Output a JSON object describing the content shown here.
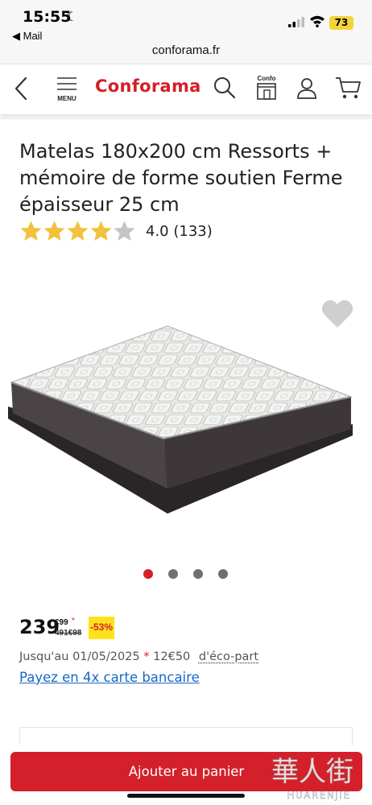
{
  "status_bar": {
    "time": "15:55",
    "back_app": "◀ Mail",
    "battery": "73"
  },
  "browser": {
    "url": "conforama.fr"
  },
  "header": {
    "menu_label": "MENU",
    "logo": "Conforama",
    "confo_label": "Confo"
  },
  "product": {
    "title": "Matelas 180x200 cm Ressorts + mémoire de forme soutien Ferme épaisseur 25 cm",
    "rating": 4.0,
    "rating_text": "4.0 (133)",
    "image_count": 4,
    "active_image": 1
  },
  "price": {
    "main": "239",
    "cents": "€99",
    "asterisk": "*",
    "old_price": "491€98",
    "discount": "-53%"
  },
  "eco": {
    "date_text": "Jusqu'au 01/05/2025",
    "asterisk": "*",
    "amount": "12€50",
    "link": "d'éco-part"
  },
  "payment_link": "Payez en 4x carte bancaire",
  "cta": {
    "add_to_cart": "Ajouter au panier"
  },
  "watermark": {
    "chars": "華人街",
    "latin": "HUARENJIE"
  },
  "colors": {
    "brand_red": "#d3202a",
    "discount_yellow": "#ffe11b",
    "star_gold": "#f1c23b",
    "link_blue": "#1668c8"
  },
  "icons": [
    "back-chevron-icon",
    "menu-icon",
    "search-icon",
    "confo-store-icon",
    "account-icon",
    "cart-icon",
    "heart-icon",
    "star-icon"
  ]
}
